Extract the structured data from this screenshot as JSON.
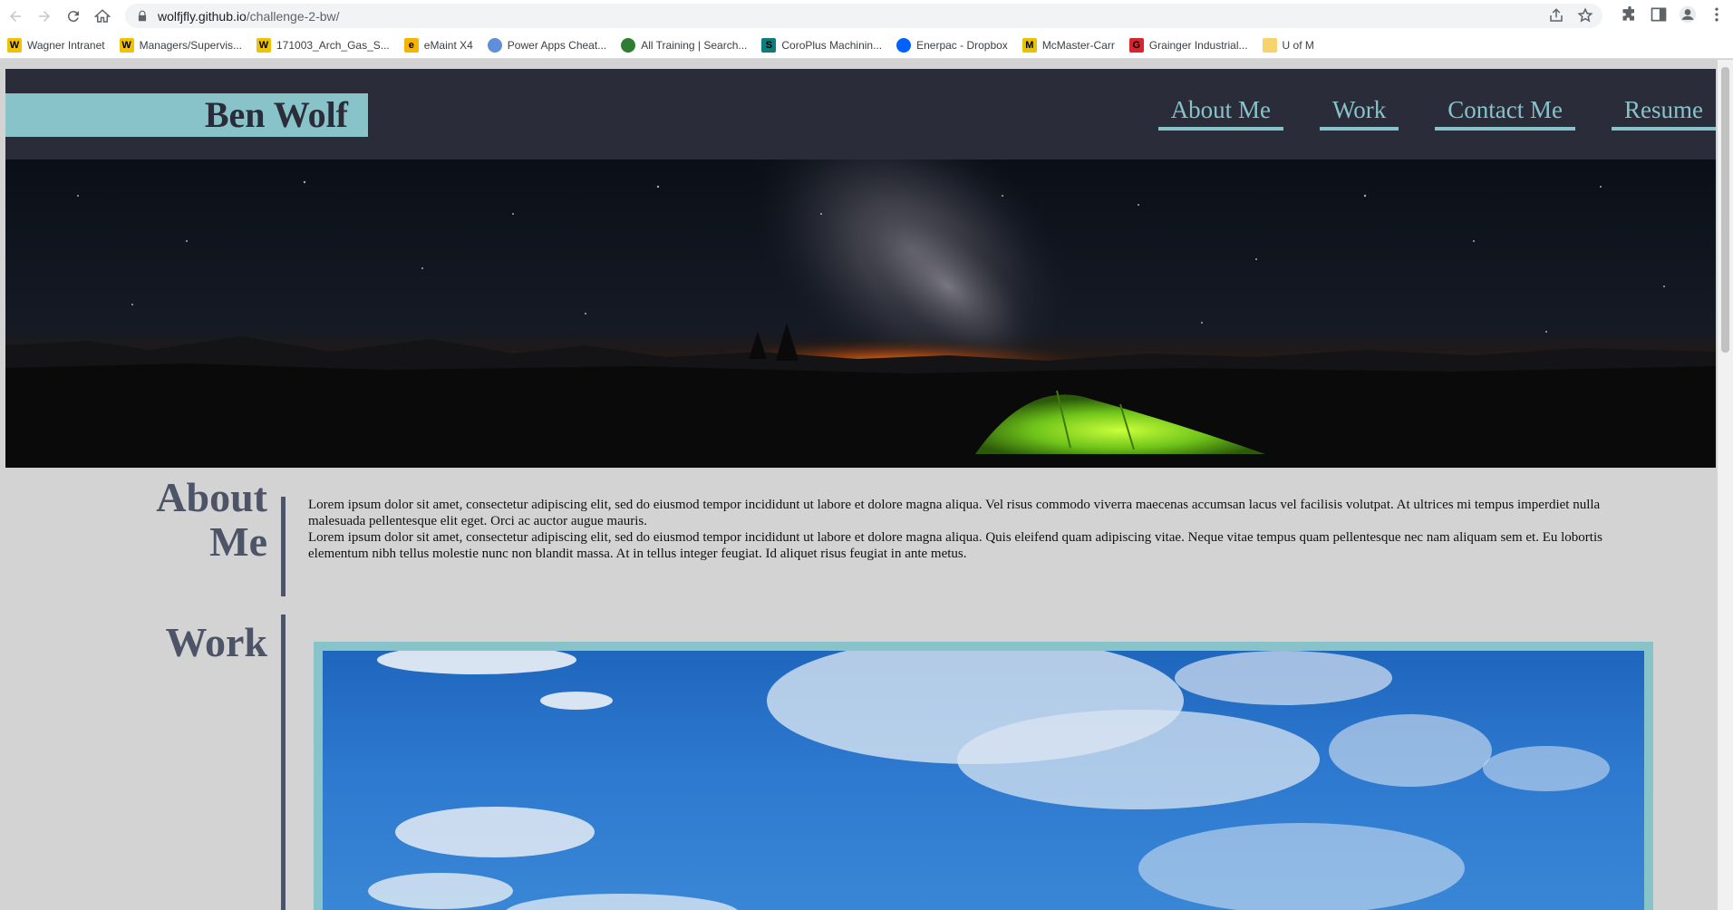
{
  "browser": {
    "url_host": "wolfjfly.github.io",
    "url_path": "/challenge-2-bw/",
    "bookmarks": [
      {
        "label": "Wagner Intranet",
        "icon": "W",
        "color": "#f2c200"
      },
      {
        "label": "Managers/Supervis...",
        "icon": "W",
        "color": "#f2c200"
      },
      {
        "label": "171003_Arch_Gas_S...",
        "icon": "W",
        "color": "#f2c200"
      },
      {
        "label": "eMaint X4",
        "icon": "e",
        "color": "#f5b400"
      },
      {
        "label": "Power Apps Cheat...",
        "icon": "lightbulb-icon",
        "color": "#5f8fd6"
      },
      {
        "label": "All Training | Search...",
        "icon": "layers-icon",
        "color": "#2e7d32"
      },
      {
        "label": "CoroPlus Machinin...",
        "icon": "S",
        "color": "#0b7d7d"
      },
      {
        "label": "Enerpac - Dropbox",
        "icon": "dropbox-icon",
        "color": "#0061fe"
      },
      {
        "label": "McMaster-Carr",
        "icon": "M",
        "color": "#e8c200"
      },
      {
        "label": "Grainger Industrial...",
        "icon": "G",
        "color": "#d9232d"
      },
      {
        "label": "U of M",
        "icon": "folder-icon",
        "color": "#f6d46b"
      }
    ]
  },
  "site": {
    "logo": "Ben Wolf",
    "nav": [
      "About Me",
      "Work",
      "Contact Me",
      "Resume"
    ],
    "about": {
      "title_line1": "About",
      "title_line2": "Me",
      "paragraph1": "Lorem ipsum dolor sit amet, consectetur adipiscing elit, sed do eiusmod tempor incididunt ut labore et dolore magna aliqua. Vel risus commodo viverra maecenas accumsan lacus vel facilisis volutpat. At ultrices mi tempus imperdiet nulla malesuada pellentesque elit eget. Orci ac auctor augue mauris.",
      "paragraph2": "Lorem ipsum dolor sit amet, consectetur adipiscing elit, sed do eiusmod tempor incididunt ut labore et dolore magna aliqua. Quis eleifend quam adipiscing vitae. Neque vitae tempus quam pellentesque nec nam aliquam sem et. Eu lobortis elementum nibh tellus molestie nunc non blandit massa. At in tellus integer feugiat. Id aliquet risus feugiat in ante metus."
    },
    "work": {
      "title": "Work"
    },
    "colors": {
      "header_bg": "#2a2c39",
      "accent": "#87c3c9",
      "heading": "#4d5468",
      "page_bg": "#d3d3d3"
    }
  }
}
